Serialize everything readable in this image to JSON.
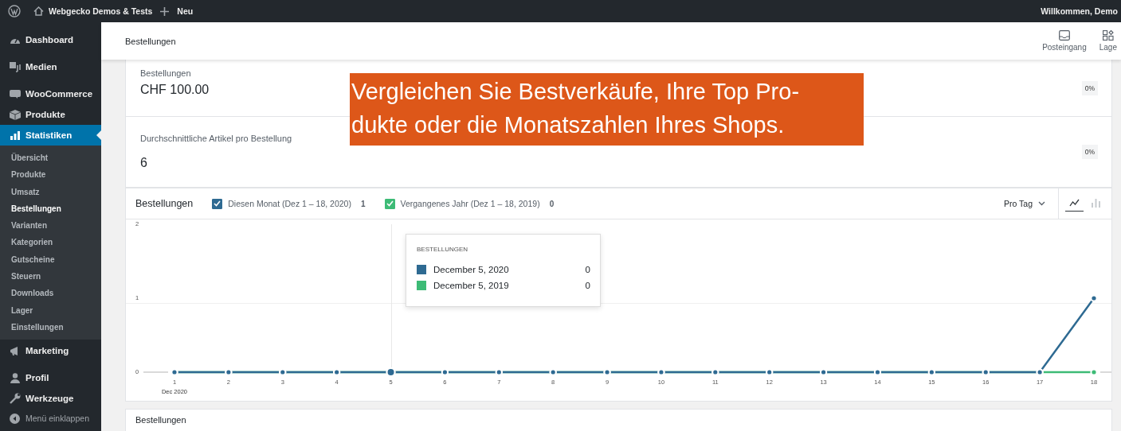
{
  "top_bar": {
    "site_name": "Webgecko Demos & Tests",
    "new_label": "Neu",
    "greeting": "Willkommen, Demo"
  },
  "sidebar": {
    "items": [
      {
        "label": "Dashboard",
        "selected": false
      },
      {
        "label": "Medien",
        "selected": false
      },
      {
        "label": "WooCommerce",
        "selected": false
      },
      {
        "label": "Produkte",
        "selected": false
      },
      {
        "label": "Statistiken",
        "selected": true,
        "children": [
          {
            "label": "Übersicht",
            "selected": false
          },
          {
            "label": "Produkte",
            "selected": false
          },
          {
            "label": "Umsatz",
            "selected": false
          },
          {
            "label": "Bestellungen",
            "selected": true
          },
          {
            "label": "Varianten",
            "selected": false
          },
          {
            "label": "Kategorien",
            "selected": false
          },
          {
            "label": "Gutscheine",
            "selected": false
          },
          {
            "label": "Steuern",
            "selected": false
          },
          {
            "label": "Downloads",
            "selected": false
          },
          {
            "label": "Lager",
            "selected": false
          },
          {
            "label": "Einstellungen",
            "selected": false
          }
        ]
      },
      {
        "label": "Marketing",
        "selected": false
      },
      {
        "label": "Profil",
        "selected": false
      },
      {
        "label": "Werkzeuge",
        "selected": false
      }
    ],
    "collapse_label": "Menü einklappen"
  },
  "header": {
    "title": "Bestellungen",
    "actions": [
      {
        "label": "Posteingang"
      },
      {
        "label": "Lage"
      }
    ]
  },
  "stats": [
    {
      "label": "Bestellungen",
      "value": "CHF 100.00",
      "delta": "0%"
    },
    {
      "label": "Durchschnittliche Artikel pro Bestellung",
      "value": "6",
      "delta": "0%"
    }
  ],
  "chart_panel": {
    "title": "Bestellungen",
    "legend": [
      {
        "count": "1",
        "checked": true
      },
      {
        "count": "0",
        "checked": true
      }
    ],
    "interval": "Pro Tag",
    "chart_types": [
      {
        "kind": "line",
        "selected": true
      },
      {
        "kind": "bar",
        "selected": false
      }
    ],
    "tooltip": {
      "title": "BESTELLUNGEN",
      "hover_category": "5",
      "rows": [
        {
          "label": "December 5, 2020",
          "value": "0",
          "color": "#2e6a92"
        },
        {
          "label": "December 5, 2019",
          "value": "0",
          "color": "#3dbb76"
        }
      ]
    },
    "chart_data": {
      "type": "line",
      "xlabel": "Dec 2020",
      "categories": [
        "1",
        "2",
        "3",
        "4",
        "5",
        "6",
        "7",
        "8",
        "9",
        "10",
        "11",
        "12",
        "13",
        "14",
        "15",
        "16",
        "17",
        "18"
      ],
      "series": [
        {
          "name": "Diesen Monat (Dez 1 – 18, 2020)",
          "color": "#2e6a92",
          "marker": "circle",
          "values": [
            0,
            0,
            0,
            0,
            0,
            0,
            0,
            0,
            0,
            0,
            0,
            0,
            0,
            0,
            0,
            0,
            0,
            1
          ]
        },
        {
          "name": "Vergangenes Jahr (Dez 1 – 18, 2019)",
          "color": "#3dbb76",
          "marker": "circle",
          "values": [
            0,
            0,
            0,
            0,
            0,
            0,
            0,
            0,
            0,
            0,
            0,
            0,
            0,
            0,
            0,
            0,
            0,
            0
          ]
        }
      ],
      "ylim": [
        0,
        2
      ],
      "yticks": [
        0,
        1,
        2
      ]
    }
  },
  "next_panel": {
    "title": "Bestellungen"
  },
  "overlay_caption": {
    "lines": [
      "Vergleichen Sie Bestverkäufe, Ihre Top Pro-",
      "dukte oder die Monatszahlen Ihres Shops."
    ]
  }
}
